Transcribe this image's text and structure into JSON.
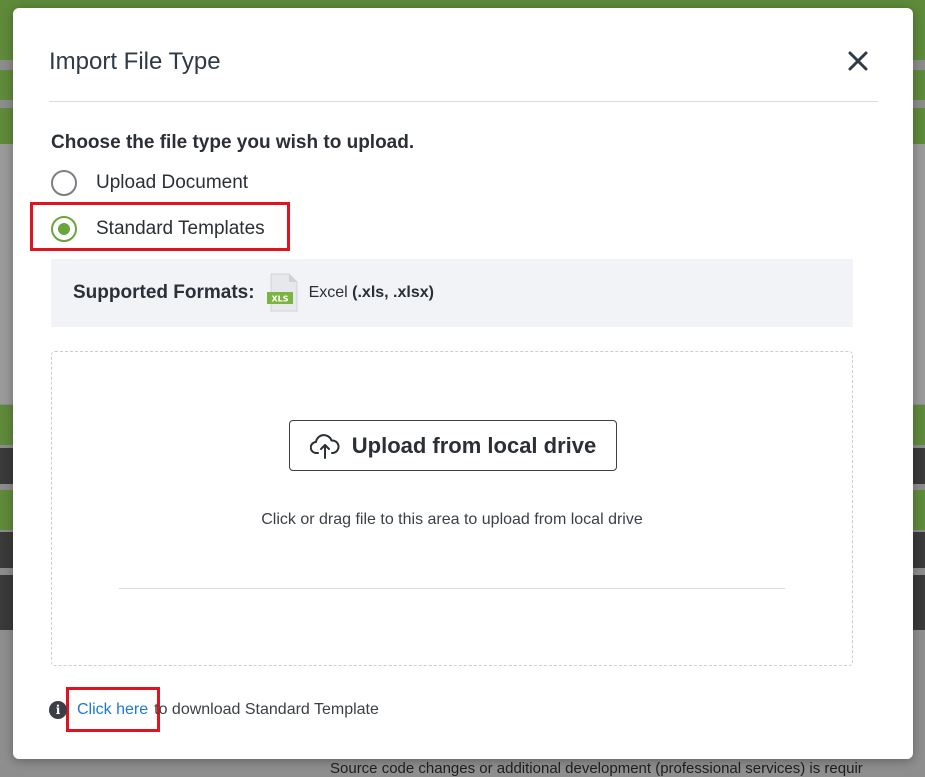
{
  "background": {
    "bottom_text": "Source code changes or additional development (professional services) is requir"
  },
  "modal": {
    "title": "Import File Type",
    "close_icon": "close-icon"
  },
  "file_type": {
    "prompt": "Choose the file type you wish to upload.",
    "options": [
      {
        "label": "Upload Document",
        "selected": false
      },
      {
        "label": "Standard Templates",
        "selected": true
      }
    ]
  },
  "formats": {
    "label": "Supported Formats:",
    "icon": "xls-file-icon",
    "icon_text": "XLS",
    "type_name": "Excel",
    "extensions": "(.xls, .xlsx)"
  },
  "dropzone": {
    "button_label": "Upload from local drive",
    "button_icon": "cloud-upload-icon",
    "hint": "Click or drag file to this area to upload from local drive"
  },
  "footer": {
    "link_text": "Click here",
    "text": "to download Standard Template"
  },
  "colors": {
    "accent_green": "#6aa53a",
    "link_blue": "#1f78d1",
    "highlight_red": "#e0141e",
    "xls_green": "#7cb342"
  }
}
